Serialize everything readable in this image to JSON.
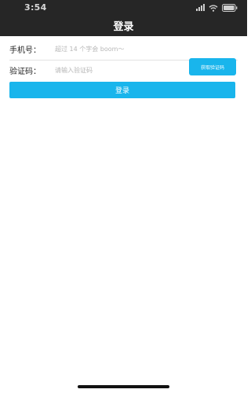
{
  "status_bar": {
    "time": "3:54",
    "icons": [
      "signal-icon",
      "wifi-icon",
      "battery-icon"
    ]
  },
  "nav": {
    "title": "登录"
  },
  "form": {
    "phone": {
      "label": "手机号：",
      "value": "",
      "placeholder": "超过 14 个字会 boom～"
    },
    "code": {
      "label": "验证码：",
      "value": "",
      "placeholder": "请输入验证码"
    },
    "get_code_label": "获取验证码",
    "submit_label": "登录"
  },
  "colors": {
    "nav_background": "#262626",
    "accent": "#19b5ec"
  }
}
